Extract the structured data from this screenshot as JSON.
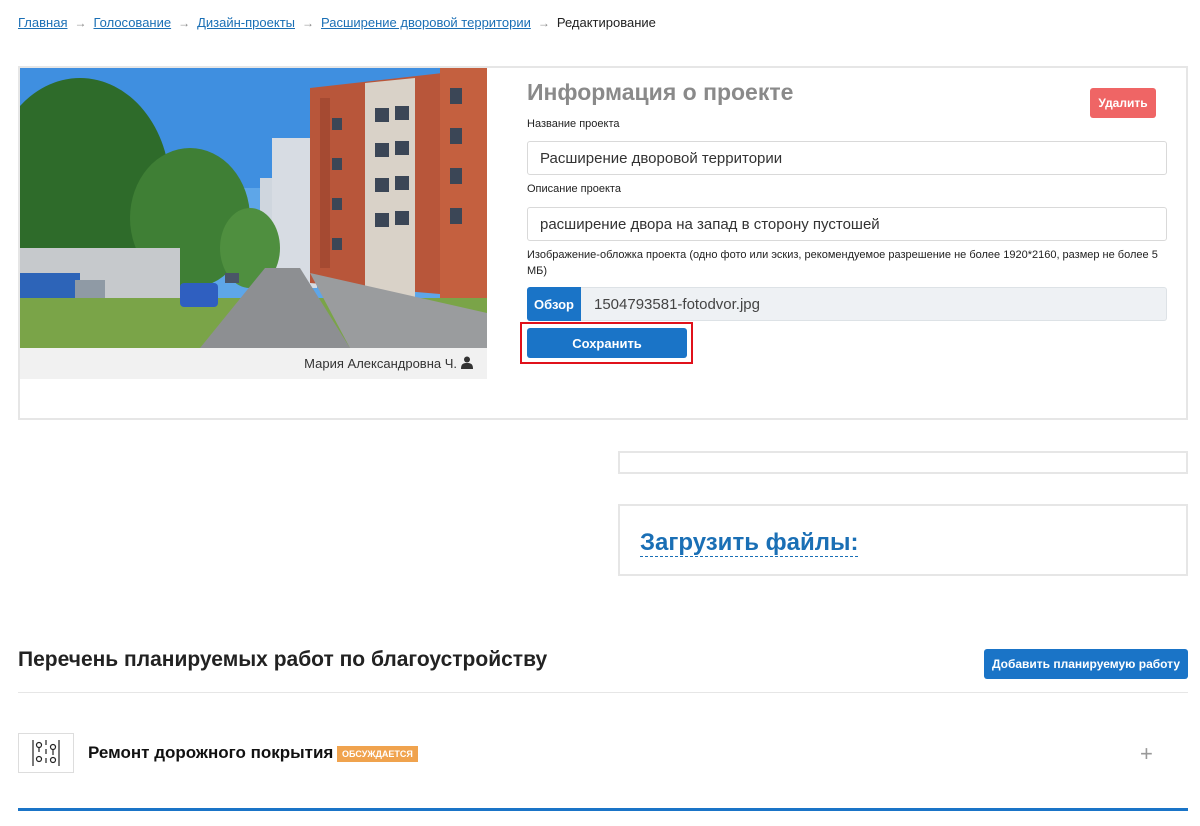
{
  "breadcrumb": {
    "items": [
      "Главная",
      "Голосование",
      "Дизайн-проекты",
      "Расширение дворовой территории"
    ],
    "separator": "→",
    "current": "Редактирование"
  },
  "project": {
    "photo_author": "Мария Александровна Ч.",
    "info_title": "Информация о проекте",
    "delete_label": "Удалить",
    "name_label": "Название проекта",
    "name_value": "Расширение дворовой территории",
    "desc_label": "Описание проекта",
    "desc_value": "расширение двора на запад в сторону пустошей",
    "cover_label": "Изображение-обложка проекта (одно фото или эскиз, рекомендуемое разрешение не более 1920*2160, размер не более 5 МБ)",
    "browse_label": "Обзор",
    "file_name": "1504793581-fotodvor.jpg",
    "save_label": "Сохранить"
  },
  "upload": {
    "label": "Загрузить файлы:"
  },
  "works": {
    "title": "Перечень планируемых работ по благоустройству",
    "add_label": "Добавить планируемую работу",
    "items": [
      {
        "name": "Ремонт дорожного покрытия",
        "status": "ОБСУЖДАЕТСЯ",
        "expand": "+"
      }
    ]
  },
  "colors": {
    "primary": "#1a74c7",
    "link": "#1a6fb5",
    "danger": "#ef6565",
    "badge": "#f0a34e",
    "highlight": "#e0111b"
  }
}
